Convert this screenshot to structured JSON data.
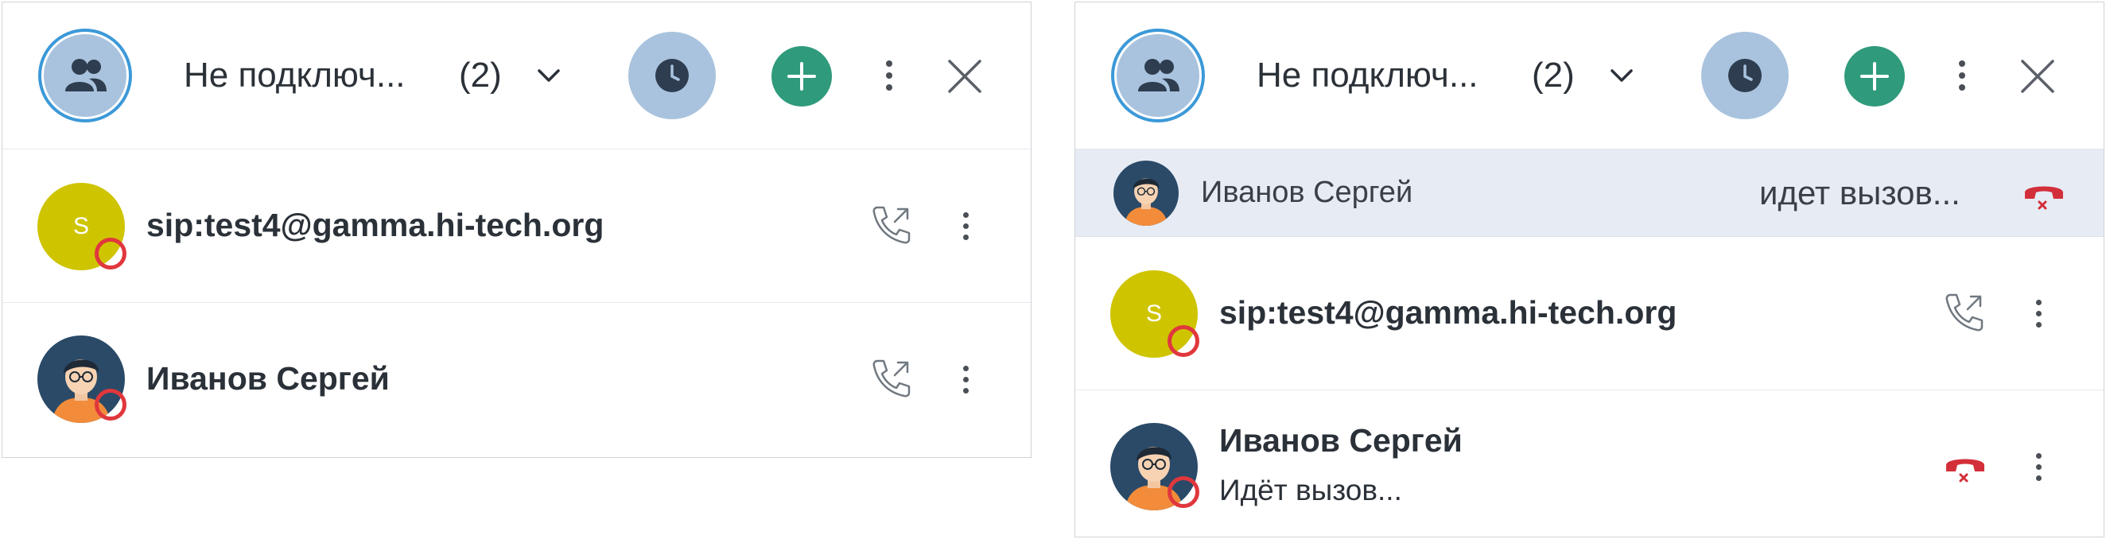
{
  "header": {
    "title": "Не подключ...",
    "count": "(2)"
  },
  "contacts": [
    {
      "name": "sip:test4@gamma.hi-tech.org",
      "initial": "S"
    },
    {
      "name": "Иванов Сергей"
    }
  ],
  "active_call": {
    "name": "Иванов Сергей",
    "status": "идет вызов..."
  },
  "panel_b_contacts": [
    {
      "name": "sip:test4@gamma.hi-tech.org",
      "initial": "S"
    },
    {
      "name": "Иванов Сергей",
      "status": "Идёт вызов..."
    }
  ],
  "colors": {
    "accent_green": "#2f9a7c",
    "avatar_blue": "#a9c3de",
    "sip_avatar": "#cfc400",
    "status_red": "#e0373d",
    "hangup_red": "#d32f3a"
  },
  "icons": [
    "group-icon",
    "chevron-down-icon",
    "clock-icon",
    "plus-icon",
    "more-vertical-icon",
    "close-icon",
    "outgoing-call-icon",
    "hangup-icon",
    "user-avatar-icon"
  ]
}
